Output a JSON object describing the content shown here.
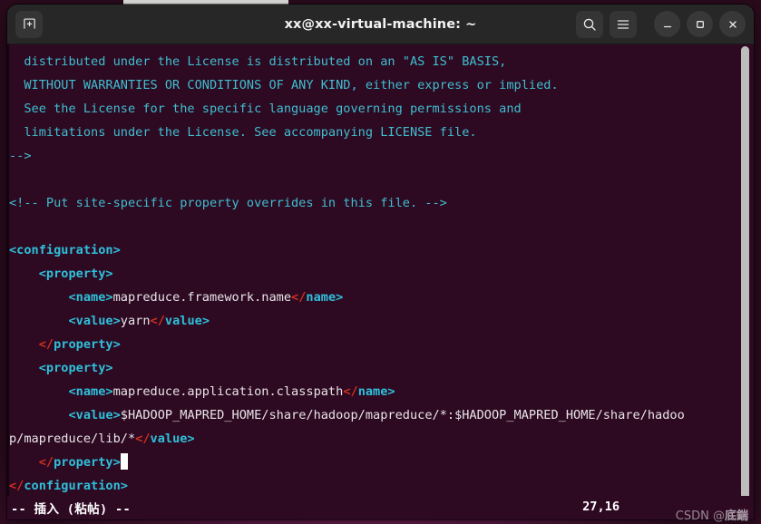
{
  "window": {
    "title": "xx@xx-virtual-machine: ~",
    "new_tab_icon": "new-tab-icon",
    "search_icon": "search-icon",
    "menu_icon": "hamburger-menu-icon",
    "minimize_icon": "minimize-icon",
    "maximize_icon": "maximize-icon",
    "close_icon": "close-icon"
  },
  "editor": {
    "lines": [
      {
        "id": "l1",
        "segments": [
          {
            "cls": "cmt",
            "t": "  distributed under the License is distributed on an \"AS IS\" BASIS,"
          }
        ]
      },
      {
        "id": "l2",
        "segments": [
          {
            "cls": "cmt",
            "t": "  WITHOUT WARRANTIES OR CONDITIONS OF ANY KIND, either express or implied."
          }
        ]
      },
      {
        "id": "l3",
        "segments": [
          {
            "cls": "cmt",
            "t": "  See the License for the specific language governing permissions and"
          }
        ]
      },
      {
        "id": "l4",
        "segments": [
          {
            "cls": "cmt",
            "t": "  limitations under the License. See accompanying LICENSE file."
          }
        ]
      },
      {
        "id": "l5",
        "segments": [
          {
            "cls": "cmt",
            "t": "-->"
          }
        ]
      },
      {
        "id": "l6",
        "segments": [
          {
            "cls": "txt",
            "t": ""
          }
        ]
      },
      {
        "id": "l7",
        "segments": [
          {
            "cls": "cmt",
            "t": "<!-- Put site-specific property overrides in this file. -->"
          }
        ]
      },
      {
        "id": "l8",
        "segments": [
          {
            "cls": "txt",
            "t": ""
          }
        ]
      },
      {
        "id": "l9",
        "segments": [
          {
            "cls": "tag",
            "t": "<configuration>"
          }
        ]
      },
      {
        "id": "l10",
        "segments": [
          {
            "cls": "txt",
            "t": "    "
          },
          {
            "cls": "tag",
            "t": "<property>"
          }
        ]
      },
      {
        "id": "l11",
        "segments": [
          {
            "cls": "txt",
            "t": "        "
          },
          {
            "cls": "tag",
            "t": "<name>"
          },
          {
            "cls": "txt",
            "t": "mapreduce.framework.name"
          },
          {
            "cls": "slash",
            "t": "</"
          },
          {
            "cls": "tagc",
            "t": "name>"
          }
        ]
      },
      {
        "id": "l12",
        "segments": [
          {
            "cls": "txt",
            "t": "        "
          },
          {
            "cls": "tag",
            "t": "<value>"
          },
          {
            "cls": "txt",
            "t": "yarn"
          },
          {
            "cls": "slash",
            "t": "</"
          },
          {
            "cls": "tagc",
            "t": "value>"
          }
        ]
      },
      {
        "id": "l13",
        "segments": [
          {
            "cls": "txt",
            "t": "    "
          },
          {
            "cls": "slash",
            "t": "</"
          },
          {
            "cls": "tagc",
            "t": "property>"
          }
        ]
      },
      {
        "id": "l14",
        "segments": [
          {
            "cls": "txt",
            "t": "    "
          },
          {
            "cls": "tag",
            "t": "<property>"
          }
        ]
      },
      {
        "id": "l15",
        "segments": [
          {
            "cls": "txt",
            "t": "        "
          },
          {
            "cls": "tag",
            "t": "<name>"
          },
          {
            "cls": "txt",
            "t": "mapreduce.application.classpath"
          },
          {
            "cls": "slash",
            "t": "</"
          },
          {
            "cls": "tagc",
            "t": "name>"
          }
        ]
      },
      {
        "id": "l16",
        "segments": [
          {
            "cls": "txt",
            "t": "        "
          },
          {
            "cls": "tag",
            "t": "<value>"
          },
          {
            "cls": "txt",
            "t": "$HADOOP_MAPRED_HOME/share/hadoop/mapreduce/*:$HADOOP_MAPRED_HOME/share/hadoo"
          }
        ]
      },
      {
        "id": "l17",
        "segments": [
          {
            "cls": "txt",
            "t": "p/mapreduce/lib/*"
          },
          {
            "cls": "slash",
            "t": "</"
          },
          {
            "cls": "tagc",
            "t": "value>"
          }
        ]
      },
      {
        "id": "l18",
        "segments": [
          {
            "cls": "txt",
            "t": "    "
          },
          {
            "cls": "slash",
            "t": "</"
          },
          {
            "cls": "tagc",
            "t": "property>"
          },
          {
            "cls": "cursor",
            "t": " "
          }
        ]
      },
      {
        "id": "l19",
        "segments": [
          {
            "cls": "slash",
            "t": "</"
          },
          {
            "cls": "tagc",
            "t": "configuration>"
          }
        ]
      }
    ]
  },
  "status": {
    "mode": "-- 插入 (粘帖) --",
    "position": "27,16"
  },
  "watermark": {
    "prefix": "CSDN @",
    "name": "底鍴"
  },
  "colors": {
    "terminal_bg": "#2d0922",
    "titlebar_bg": "#272727",
    "comment": "#3fbfcf",
    "tag": "#2fc0da",
    "closing_slash": "#d03020",
    "text": "#e9e5e8",
    "cursor": "#ffffff",
    "scrollbar": "#bdbdbd"
  }
}
